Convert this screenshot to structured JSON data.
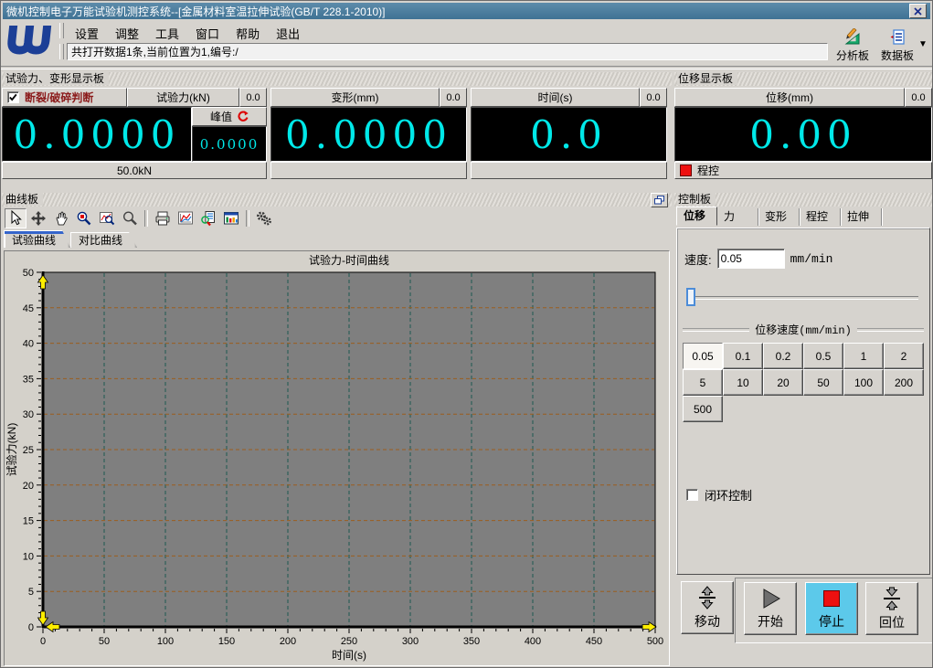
{
  "window": {
    "title": "微机控制电子万能试验机测控系统--[金属材料室温拉伸试验(GB/T 228.1-2010)]"
  },
  "menu": {
    "items": [
      "设置",
      "调整",
      "工具",
      "窗口",
      "帮助",
      "退出"
    ]
  },
  "toolbar": {
    "status_text": "共打开数据1条,当前位置为1,编号:/",
    "analysis_label": "分析板",
    "data_label": "数据板"
  },
  "force_panel": {
    "title": "试验力、变形显示板",
    "fracture_label": "断裂/破碎判断",
    "fracture_checked": true,
    "force_header": "试验力(kN)",
    "force_aux": "0.0",
    "force_value": "0.0000",
    "peak_label": "峰值",
    "peak_value": "0.0000",
    "range_label": "50.0kN",
    "deform_header": "变形(mm)",
    "deform_aux": "0.0",
    "deform_value": "0.0000",
    "time_header": "时间(s)",
    "time_aux": "0.0",
    "time_value": "0.0"
  },
  "displacement_panel": {
    "title": "位移显示板",
    "header": "位移(mm)",
    "aux": "0.0",
    "value": "0.00",
    "mode_label": "程控"
  },
  "curve_panel": {
    "title": "曲线板",
    "tools": [
      "select",
      "move",
      "pan",
      "zoom-region",
      "zoom-curve",
      "zoom",
      "sep",
      "print",
      "curve-style",
      "curve-inspect",
      "data-window",
      "sep",
      "gears"
    ],
    "active_tool": "select",
    "tabs": [
      "试验曲线",
      "对比曲线"
    ],
    "active_tab": 0
  },
  "chart_data": {
    "type": "line",
    "title": "试验力-时间曲线",
    "xlabel": "时间(s)",
    "ylabel": "试验力(kN)",
    "xlim": [
      0,
      500
    ],
    "ylim": [
      0,
      50
    ],
    "x_ticks": [
      0,
      50,
      100,
      150,
      200,
      250,
      300,
      350,
      400,
      450,
      500
    ],
    "y_ticks": [
      0,
      5,
      10,
      15,
      20,
      25,
      30,
      35,
      40,
      45,
      50
    ],
    "x_minor_step": 10,
    "y_minor_step": 1,
    "grid": true,
    "legend": false,
    "series": [],
    "plot_bg": "#7f7f7f",
    "v_grid_color": "#1d5a50",
    "h_grid_color": "#9c5e1e",
    "marker_color": "#ffee00"
  },
  "control_panel": {
    "title": "控制板",
    "tabs": [
      "位移",
      "力",
      "变形",
      "程控",
      "拉伸"
    ],
    "active_tab": 0,
    "speed_label": "速度:",
    "speed_value": "0.05",
    "speed_unit": "mm/min",
    "group_title": "位移速度(mm/min)",
    "speed_options": [
      "0.05",
      "0.1",
      "0.2",
      "0.5",
      "1",
      "2",
      "5",
      "10",
      "20",
      "50",
      "100",
      "200",
      "500"
    ],
    "selected_speed": "0.05",
    "closed_loop_label": "闭环控制",
    "closed_loop_checked": false,
    "move_label": "移动",
    "start_label": "开始",
    "stop_label": "停止",
    "home_label": "回位",
    "stop_active_color": "#5cc9ea"
  }
}
